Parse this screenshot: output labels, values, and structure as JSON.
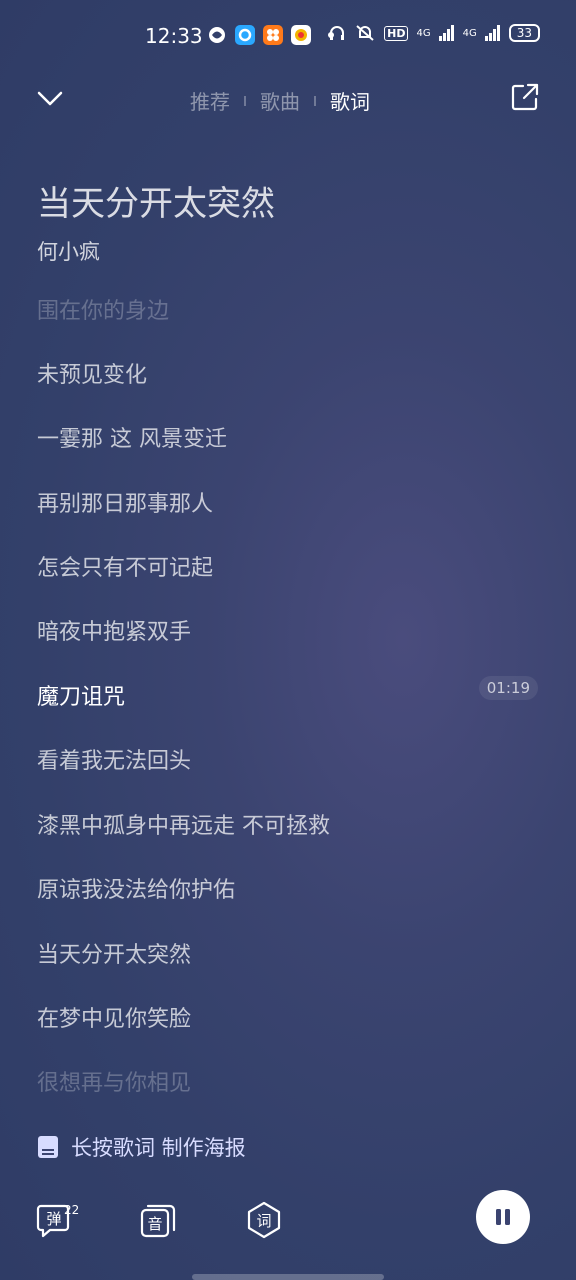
{
  "status_bar": {
    "time": "12:33",
    "hd": "HD",
    "net1": "4G",
    "net2": "4G",
    "battery": "33"
  },
  "nav": {
    "tabs": [
      {
        "label": "推荐",
        "active": false
      },
      {
        "label": "歌曲",
        "active": false
      },
      {
        "label": "歌词",
        "active": true
      }
    ]
  },
  "song": {
    "title": "当天分开太突然",
    "artist": "何小疯"
  },
  "lyrics": [
    "围在你的身边",
    "未预见变化",
    "一霎那 这 风景变迁",
    "再别那日那事那人",
    "怎会只有不可记起",
    "暗夜中抱紧双手",
    "魔刀诅咒",
    "看着我无法回头",
    "漆黑中孤身中再远走 不可拯救",
    "原谅我没法给你护佑",
    "当天分开太突然",
    "在梦中见你笑脸",
    "很想再与你相见"
  ],
  "current_time": "01:19",
  "poster_hint": "长按歌词 制作海报",
  "controls": {
    "danmu": "弹",
    "danmu_count": "22",
    "audio": "音",
    "lyric": "词"
  },
  "colors": {
    "accent_text": "#d8dcff",
    "background": "#33406a"
  }
}
